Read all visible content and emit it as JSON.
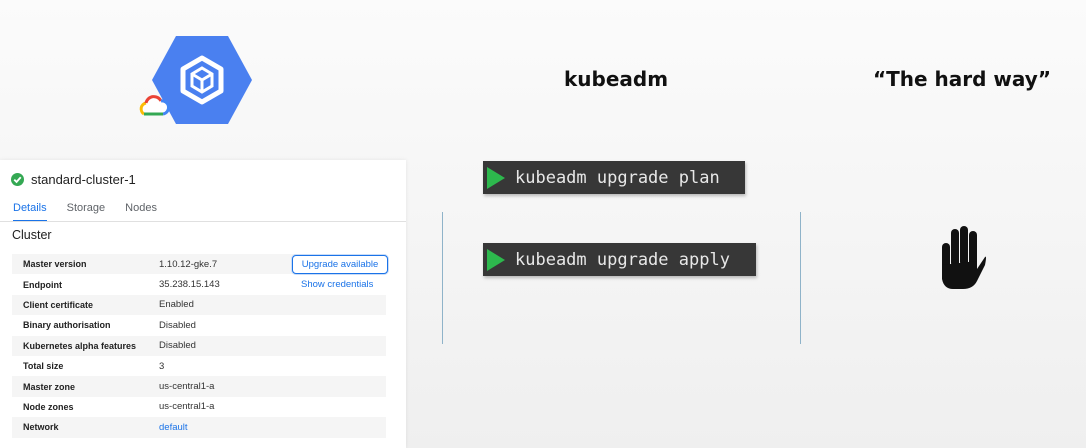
{
  "headings": {
    "kubeadm": "kubeadm",
    "hard_way": "“The hard way”"
  },
  "commands": [
    {
      "text": "kubeadm upgrade plan"
    },
    {
      "text": "kubeadm upgrade apply"
    }
  ],
  "colors": {
    "gke_blue": "#4a80f0",
    "play_green": "#2db84d",
    "link_blue": "#1a73e8",
    "terminal_bg": "#373737"
  },
  "icons": {
    "gke_logo": "gke-hexagon-icon",
    "cloud": "google-cloud-icon",
    "hand": "hand-stop-icon",
    "status": "check-circle-icon"
  },
  "cluster": {
    "name": "standard-cluster-1",
    "tabs": [
      "Details",
      "Storage",
      "Nodes"
    ],
    "section_title": "Cluster",
    "upgrade_button": "Upgrade available",
    "show_credentials": "Show credentials",
    "rows": [
      {
        "key": "Master version",
        "value": "1.10.12-gke.7"
      },
      {
        "key": "Endpoint",
        "value": "35.238.15.143"
      },
      {
        "key": "Client certificate",
        "value": "Enabled"
      },
      {
        "key": "Binary authorisation",
        "value": "Disabled"
      },
      {
        "key": "Kubernetes alpha features",
        "value": "Disabled"
      },
      {
        "key": "Total size",
        "value": "3"
      },
      {
        "key": "Master zone",
        "value": "us-central1-a"
      },
      {
        "key": "Node zones",
        "value": "us-central1-a"
      },
      {
        "key": "Network",
        "value": "default"
      }
    ]
  }
}
